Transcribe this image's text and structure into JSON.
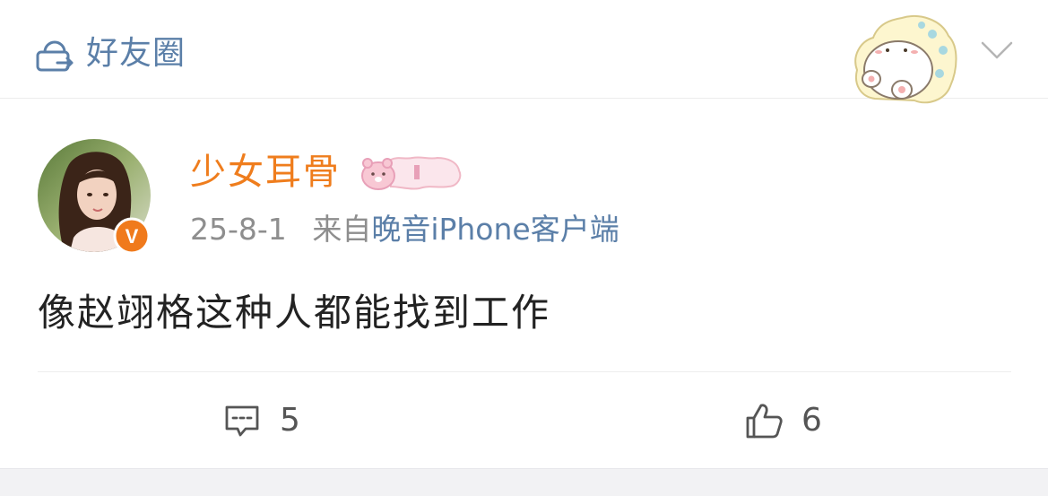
{
  "header": {
    "title": "好友圈",
    "icon": "friends-circle-icon",
    "sticker": "bear-sticker",
    "dropdown_icon": "chevron-down-icon"
  },
  "post": {
    "username": "少女耳骨",
    "avatar": "user-avatar-photo",
    "verified_badge": "V",
    "member_badge": "bear-vip-badge",
    "date": "25-8-1",
    "from_label": "来自",
    "source": "晚音iPhone客户端",
    "content": "像赵翊格这种人都能找到工作"
  },
  "actions": {
    "comment_icon": "comment-icon",
    "comment_count": "5",
    "like_icon": "thumbs-up-icon",
    "like_count": "6"
  },
  "colors": {
    "username": "#ef7d1d",
    "link_blue": "#5b7fa8",
    "meta_gray": "#8e8e8e",
    "verified_orange": "#f07a1c"
  }
}
